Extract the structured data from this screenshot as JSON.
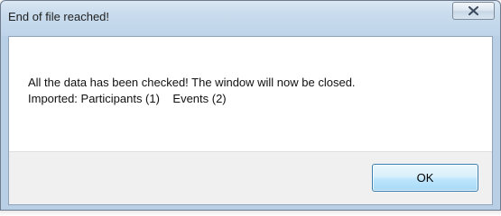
{
  "window": {
    "title": "End of file reached!",
    "close_icon": "close-icon"
  },
  "message": {
    "line1": "All the data has been checked! The window will now be closed.",
    "line2": "Imported: Participants (1)    Events (2)"
  },
  "buttons": {
    "ok_label": "OK"
  },
  "colors": {
    "titlebar": "#c9dced",
    "client_bg": "#ffffff",
    "footer_bg": "#f0f0f0",
    "ok_border": "#3c7fb1"
  }
}
